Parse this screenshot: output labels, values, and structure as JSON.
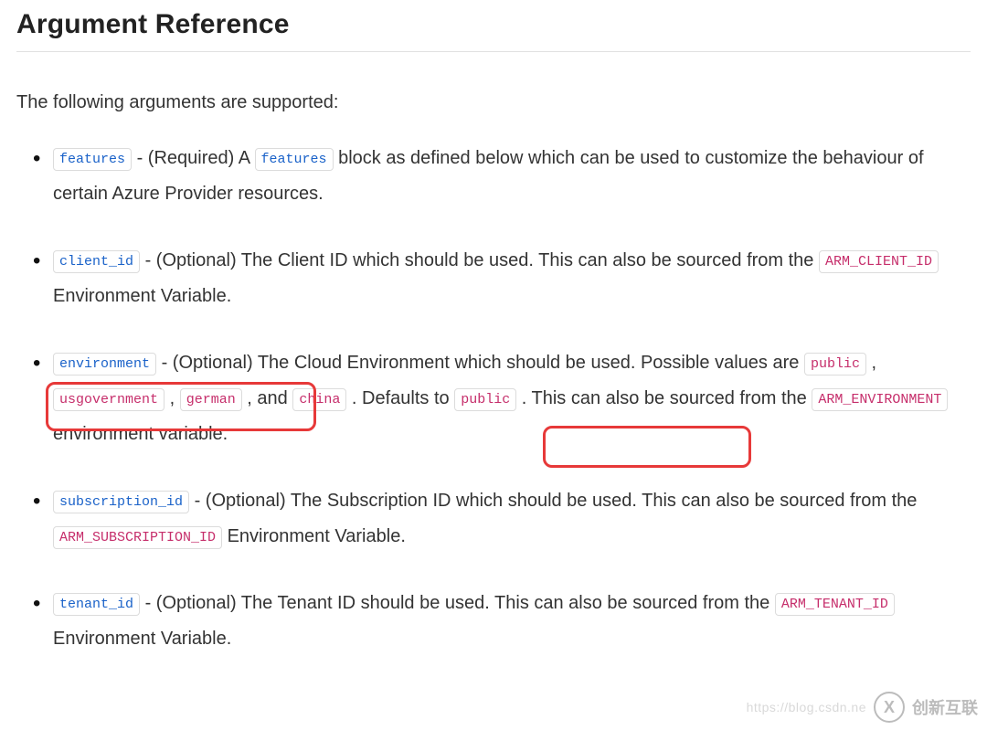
{
  "heading": "Argument Reference",
  "intro": "The following arguments are supported:",
  "args": [
    {
      "name": "features",
      "name_color": "blue",
      "pieces": [
        {
          "t": " - (Required) A "
        },
        {
          "code": "features",
          "color": "blue"
        },
        {
          "t": " block as defined below which can be used to customize the behaviour of certain Azure Provider resources."
        }
      ]
    },
    {
      "name": "client_id",
      "name_color": "blue",
      "pieces": [
        {
          "t": " - (Optional) The Client ID which should be used. This can also be sourced from the "
        },
        {
          "code": "ARM_CLIENT_ID",
          "color": "pink"
        },
        {
          "t": " Environment Variable."
        }
      ]
    },
    {
      "name": "environment",
      "name_color": "blue",
      "pieces": [
        {
          "t": " - (Optional) The Cloud Environment which should be used. Possible values are "
        },
        {
          "code": "public",
          "color": "pink"
        },
        {
          "t": " , "
        },
        {
          "code": "usgovernment",
          "color": "pink"
        },
        {
          "t": " , "
        },
        {
          "code": "german",
          "color": "pink"
        },
        {
          "t": " , and "
        },
        {
          "code": "china",
          "color": "pink"
        },
        {
          "t": " . Defaults to "
        },
        {
          "code": "public",
          "color": "pink"
        },
        {
          "t": " . This can also be sourced from the "
        },
        {
          "code": "ARM_ENVIRONMENT",
          "color": "pink"
        },
        {
          "t": " environment variable."
        }
      ]
    },
    {
      "name": "subscription_id",
      "name_color": "blue",
      "pieces": [
        {
          "t": " - (Optional) The Subscription ID which should be used. This can also be sourced from the "
        },
        {
          "code": "ARM_SUBSCRIPTION_ID",
          "color": "pink"
        },
        {
          "t": " Environment Variable."
        }
      ]
    },
    {
      "name": "tenant_id",
      "name_color": "blue",
      "pieces": [
        {
          "t": " - (Optional) The Tenant ID should be used. This can also be sourced from the "
        },
        {
          "code": "ARM_TENANT_ID",
          "color": "pink"
        },
        {
          "t": " Environment Variable."
        }
      ]
    }
  ],
  "watermark": {
    "url": "https://blog.csdn.ne",
    "badge_letter": "X",
    "brand": "创新互联"
  }
}
